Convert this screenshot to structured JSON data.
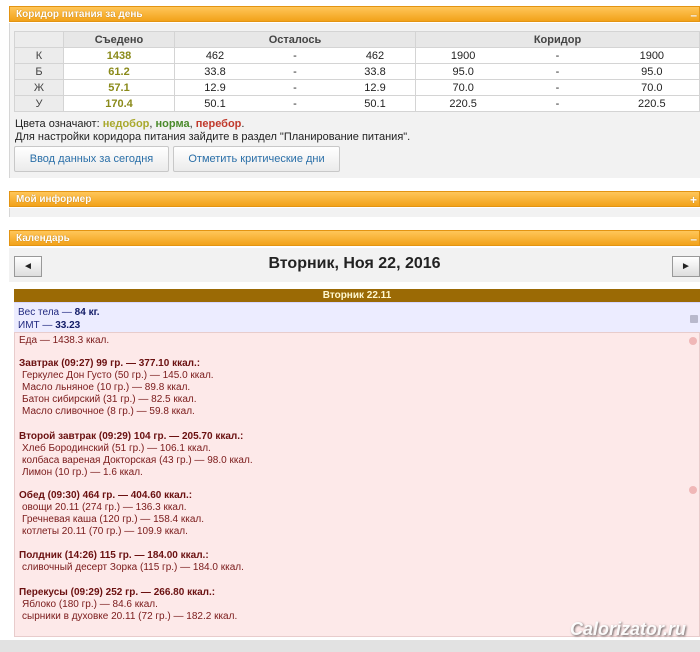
{
  "panels": {
    "corridor": {
      "title": "Коридор питания за день",
      "toggle": "–"
    },
    "informer": {
      "title": "Мой информер",
      "toggle": "+"
    },
    "calendar": {
      "title": "Календарь",
      "toggle": "–"
    }
  },
  "corridor_table": {
    "headers": [
      "Съедено",
      "Осталось",
      "Коридор"
    ],
    "rows": [
      {
        "label": "К",
        "eaten": "1438",
        "left_from": "462",
        "dash1": "-",
        "left_to": "462",
        "corr_from": "1900",
        "dash2": "-",
        "corr_to": "1900"
      },
      {
        "label": "Б",
        "eaten": "61.2",
        "left_from": "33.8",
        "dash1": "-",
        "left_to": "33.8",
        "corr_from": "95.0",
        "dash2": "-",
        "corr_to": "95.0"
      },
      {
        "label": "Ж",
        "eaten": "57.1",
        "left_from": "12.9",
        "dash1": "-",
        "left_to": "12.9",
        "corr_from": "70.0",
        "dash2": "-",
        "corr_to": "70.0"
      },
      {
        "label": "У",
        "eaten": "170.4",
        "left_from": "50.1",
        "dash1": "-",
        "left_to": "50.1",
        "corr_from": "220.5",
        "dash2": "-",
        "corr_to": "220.5"
      }
    ]
  },
  "legend": {
    "prefix": "Цвета означают:",
    "under": "недобор",
    "sep1": ",",
    "norm": "норма",
    "sep2": ",",
    "over": "перебор",
    "end": ".",
    "hint": "Для настройки коридора питания зайдите в раздел \"Планирование питания\"."
  },
  "buttons": {
    "enter_today": "Ввод данных за сегодня",
    "critical_days": "Отметить критические дни"
  },
  "calendar": {
    "prev": "◄",
    "next": "►",
    "title": "Вторник, Ноя 22, 2016",
    "day_bar": "Вторник 22.11",
    "weight": {
      "label": "Вес тела —",
      "value": "84 кг."
    },
    "bmi": {
      "label": "ИМТ —",
      "value": "33.23"
    },
    "food_total": "Еда — 1438.3 ккал.",
    "meals": [
      {
        "title": "Завтрак (09:27) 99 гр. — 377.10 ккал.:",
        "items": [
          "Геркулес Дон Густо (50 гр.) — 145.0 ккал.",
          "Масло льняное (10 гр.) — 89.8 ккал.",
          "Батон сибирский (31 гр.) — 82.5 ккал.",
          "Масло сливочное (8 гр.) — 59.8 ккал."
        ]
      },
      {
        "title": "Второй завтрак (09:29) 104 гр. — 205.70 ккал.:",
        "items": [
          "Хлеб Бородинский (51 гр.) — 106.1 ккал.",
          "колбаса вареная Докторская (43 гр.) — 98.0 ккал.",
          "Лимон (10 гр.) — 1.6 ккал."
        ]
      },
      {
        "title": "Обед (09:30) 464 гр. — 404.60 ккал.:",
        "items": [
          "овощи 20.11 (274 гр.) — 136.3 ккал.",
          "Гречневая каша (120 гр.) — 158.4 ккал.",
          "котлеты 20.11 (70 гр.) — 109.9 ккал."
        ]
      },
      {
        "title": "Полдник (14:26) 115 гр. — 184.00 ккал.:",
        "items": [
          "сливочный десерт Зорка (115 гр.) — 184.0 ккал."
        ]
      },
      {
        "title": "Перекусы (09:29) 252 гр. — 266.80 ккал.:",
        "items": [
          "Яблоко (180 гр.) — 84.6 ккал.",
          "сырники в духовке 20.11 (72 гр.) — 182.2 ккал."
        ]
      }
    ]
  },
  "watermark": "Calorizator.ru",
  "colors": {
    "header_orange": "#f2a21a",
    "day_bar": "#9b6a05",
    "food_bg": "#fde9e9",
    "weight_bg": "#ececff"
  }
}
